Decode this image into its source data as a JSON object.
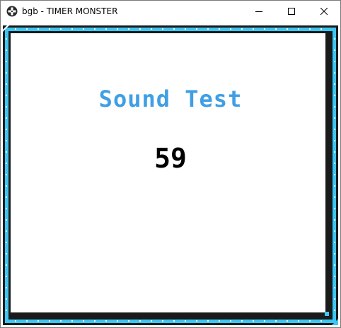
{
  "window": {
    "title": "bgb - TIMER MONSTER",
    "icon": "gameboy-dpad-icon",
    "controls": [
      "minimize-icon",
      "maximize-icon",
      "close-icon"
    ]
  },
  "screen": {
    "title": "Sound Test",
    "value": "59"
  },
  "colors": {
    "frame_blue": "#3bc6f3",
    "frame_dark": "#1a1a1a",
    "title_blue": "#3f9fe4",
    "value_black": "#000000"
  }
}
